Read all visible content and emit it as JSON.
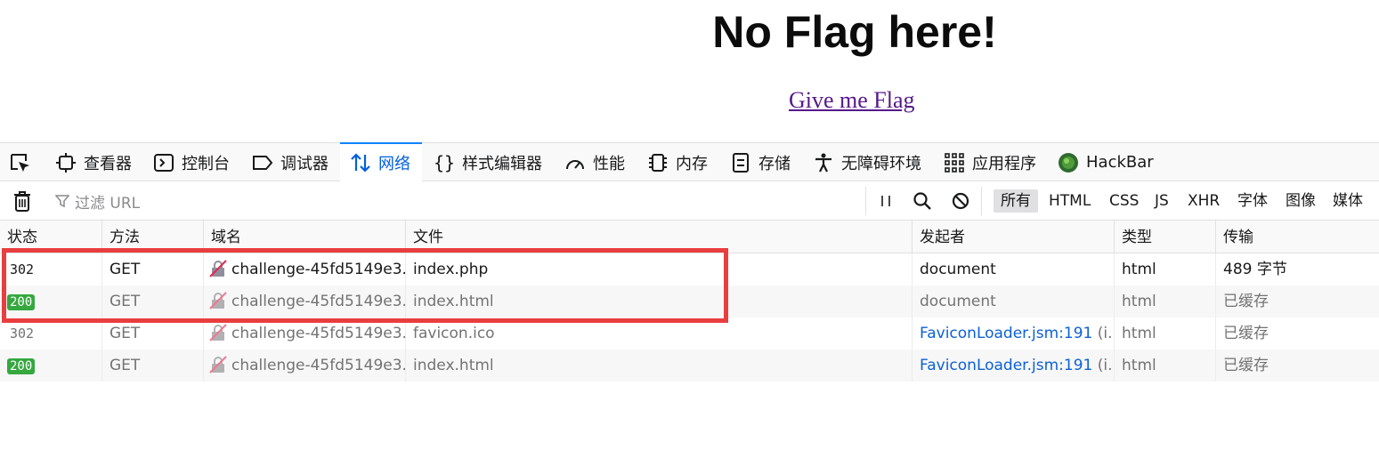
{
  "page": {
    "title": "No Flag here!",
    "link": "Give me Flag"
  },
  "devtools": {
    "tabs": [
      {
        "label": "查看器",
        "icon": "inspector-icon"
      },
      {
        "label": "控制台",
        "icon": "console-icon"
      },
      {
        "label": "调试器",
        "icon": "debugger-icon"
      },
      {
        "label": "网络",
        "icon": "network-icon"
      },
      {
        "label": "样式编辑器",
        "icon": "style-editor-icon"
      },
      {
        "label": "性能",
        "icon": "performance-icon"
      },
      {
        "label": "内存",
        "icon": "memory-icon"
      },
      {
        "label": "存储",
        "icon": "storage-icon"
      },
      {
        "label": "无障碍环境",
        "icon": "accessibility-icon"
      },
      {
        "label": "应用程序",
        "icon": "application-icon"
      },
      {
        "label": "HackBar",
        "icon": "hackbar-icon"
      }
    ],
    "selected_tab": "网络",
    "filter_placeholder": "过滤 URL",
    "type_filters": [
      "所有",
      "HTML",
      "CSS",
      "JS",
      "XHR",
      "字体",
      "图像",
      "媒体"
    ],
    "active_type_filter": "所有",
    "columns": [
      "状态",
      "方法",
      "域名",
      "文件",
      "发起者",
      "类型",
      "传输"
    ],
    "rows": [
      {
        "status": "302",
        "method": "GET",
        "domain": "challenge-45fd5149e3...",
        "file": "index.php",
        "initiator": "document",
        "initiator_suffix": "",
        "type": "html",
        "transfer": "489 字节"
      },
      {
        "status": "200",
        "method": "GET",
        "domain": "challenge-45fd5149e3...",
        "file": "index.html",
        "initiator": "document",
        "initiator_suffix": "",
        "type": "html",
        "transfer": "已缓存"
      },
      {
        "status": "302",
        "method": "GET",
        "domain": "challenge-45fd5149e3...",
        "file": "favicon.ico",
        "initiator": "FaviconLoader.jsm:191",
        "initiator_suffix": " (i...",
        "type": "html",
        "transfer": "已缓存"
      },
      {
        "status": "200",
        "method": "GET",
        "domain": "challenge-45fd5149e3...",
        "file": "index.html",
        "initiator": "FaviconLoader.jsm:191",
        "initiator_suffix": " (i...",
        "type": "html",
        "transfer": "已缓存"
      }
    ],
    "colors": {
      "accent": "#0a84ff",
      "status_ok": "#35a83f",
      "highlight": "#e83e3e"
    }
  }
}
